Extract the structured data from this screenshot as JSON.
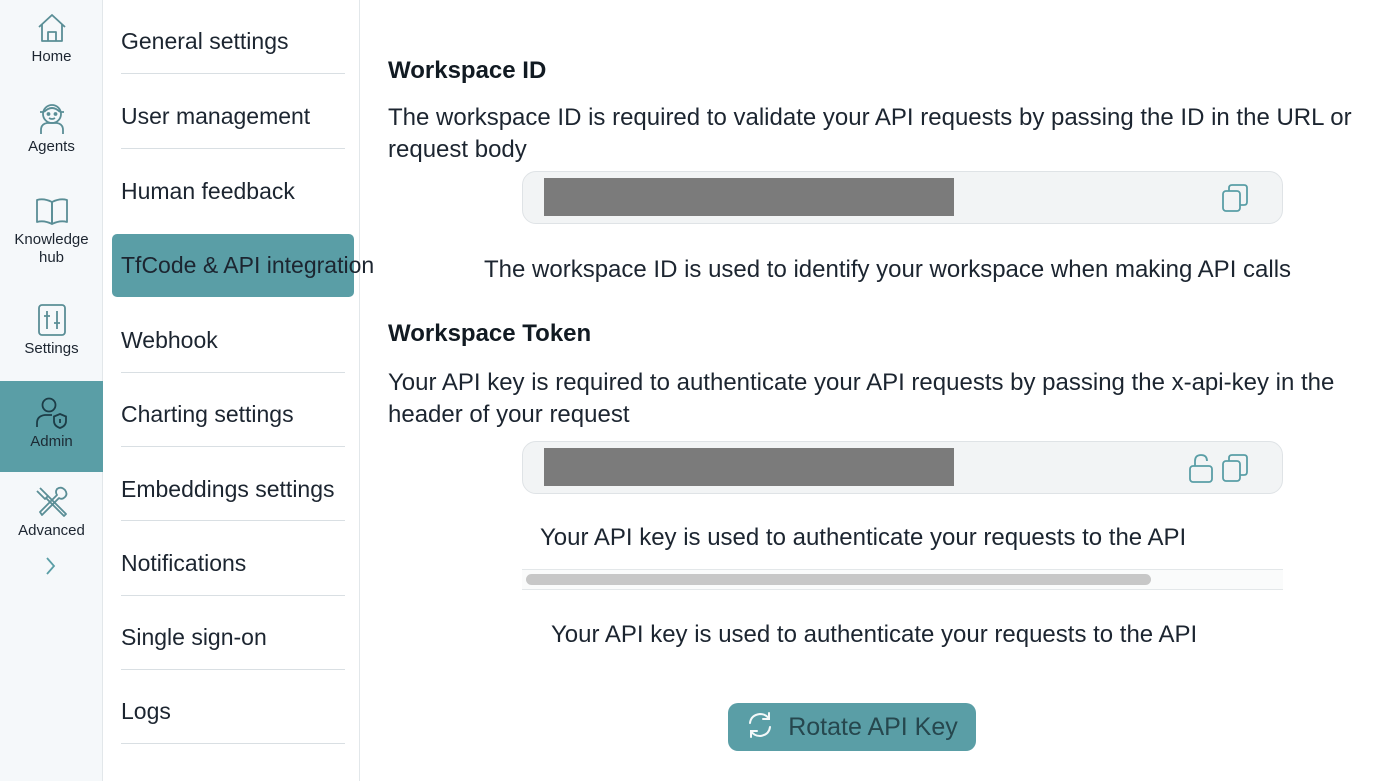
{
  "rail": {
    "items": [
      {
        "label": "Home",
        "icon": "home-icon"
      },
      {
        "label": "Agents",
        "icon": "agent-icon"
      },
      {
        "label": "Knowledge hub",
        "icon": "book-icon"
      },
      {
        "label": "Settings",
        "icon": "sliders-icon"
      },
      {
        "label": "Admin",
        "icon": "admin-user-shield-icon",
        "active": true
      },
      {
        "label": "Advanced",
        "icon": "tools-icon"
      }
    ]
  },
  "subnav": {
    "items": [
      {
        "label": "General settings"
      },
      {
        "label": "User management"
      },
      {
        "label": "Human feedback"
      },
      {
        "label": "TfCode & API integration",
        "active": true
      },
      {
        "label": "Webhook"
      },
      {
        "label": "Charting settings"
      },
      {
        "label": "Embeddings settings"
      },
      {
        "label": "Notifications"
      },
      {
        "label": "Single sign-on"
      },
      {
        "label": "Logs"
      }
    ]
  },
  "workspace_id": {
    "title": "Workspace ID",
    "description": "The workspace ID is required to validate your API requests by passing the ID in the URL or request body",
    "helper": "The workspace ID is used to identify your workspace when making API calls"
  },
  "workspace_token": {
    "title": "Workspace Token",
    "description": "Your API key is required to authenticate your API requests by passing the x-api-key in the header of your request",
    "helper": "Your API key is used to authenticate your requests to the API",
    "helper_below_scroll": "Your API key is used to authenticate your requests to the API"
  },
  "rotate_button": {
    "label": "Rotate API Key"
  },
  "colors": {
    "accent": "#5a9ea6",
    "mask": "#7b7b7b"
  }
}
